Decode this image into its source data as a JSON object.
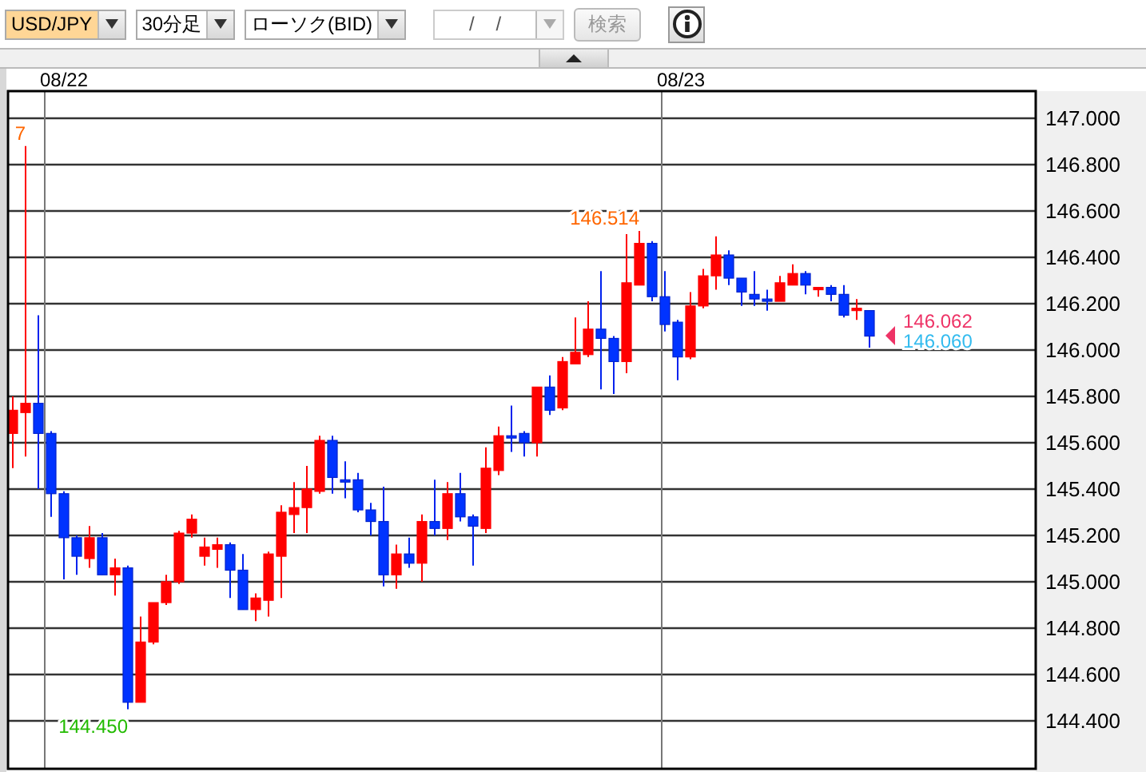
{
  "toolbar": {
    "selects": [
      {
        "value": "USD/JPY",
        "focused": true
      },
      {
        "value": "30分足",
        "focused": false
      },
      {
        "value": "ローソク(BID)",
        "focused": false
      }
    ],
    "date_field": {
      "value": "/ /",
      "disabled": true
    },
    "search_button": {
      "label": "検索",
      "disabled": true
    }
  },
  "chart": {
    "date_labels": [
      "08/22",
      "08/23"
    ],
    "price_axis_labels": [
      "147.000",
      "146.800",
      "146.600",
      "146.400",
      "146.200",
      "146.000",
      "145.800",
      "145.600",
      "145.400",
      "145.200",
      "145.000",
      "144.800",
      "144.600",
      "144.400"
    ],
    "price_labels": [
      {
        "kind": "high",
        "text": "7",
        "color": "#ff6600"
      },
      {
        "kind": "high",
        "text": "146.514",
        "color": "#ff6600"
      },
      {
        "kind": "low",
        "text": "144.450",
        "color": "#22bb00"
      },
      {
        "kind": "last",
        "text": "146.062",
        "color": "#ee3366",
        "marker": true
      },
      {
        "kind": "last",
        "text": "146.060",
        "color": "#33bbee",
        "marker": false
      }
    ]
  }
}
